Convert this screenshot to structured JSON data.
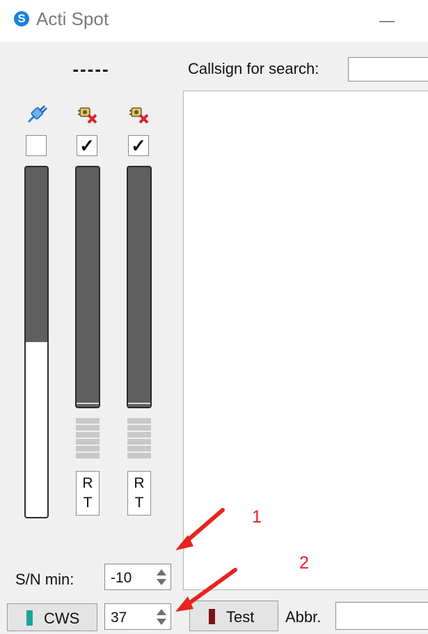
{
  "window": {
    "title": "Acti Spot",
    "logo_letter": "S"
  },
  "header": {
    "status_dashes": "-----"
  },
  "search": {
    "label": "Callsign for search:",
    "value": ""
  },
  "channels": [
    {
      "icon": "plug-icon",
      "checked": false,
      "level": 0.5
    },
    {
      "icon": "disconnected-receiver-icon",
      "checked": true,
      "level": 0,
      "rt": [
        "R",
        "T"
      ]
    },
    {
      "icon": "disconnected-receiver-icon",
      "checked": true,
      "level": 0,
      "rt": [
        "R",
        "T"
      ]
    }
  ],
  "checkmark": "✓",
  "sn": {
    "label": "S/N min:",
    "value": "-10"
  },
  "footer": {
    "cws_label": "CWS",
    "cws_led_color": "#1aa59a",
    "spin_value": "37",
    "test_label": "Test",
    "test_led_color": "#7a1414",
    "abbr_label": "Abbr.",
    "abbr_value": ""
  },
  "annotations": [
    "1",
    "2"
  ],
  "colors": {
    "annotation": "#e8231f",
    "meter_track": "#5f5f5f",
    "panel_bg": "#f0f0f0"
  }
}
